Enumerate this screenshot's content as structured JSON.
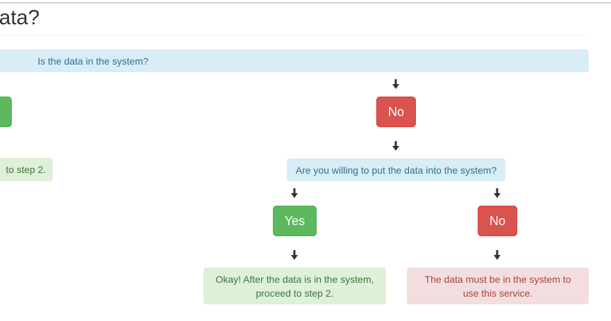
{
  "header": {
    "title": "lata?"
  },
  "question1": {
    "text": "Is the data in the system?"
  },
  "branch_left": {
    "yes_button": "",
    "result_text": "to step 2."
  },
  "branch_right": {
    "no_button": "No"
  },
  "question2": {
    "text": "Are you willing to put the data into the system?"
  },
  "sub_yes": {
    "button": "Yes",
    "result_line1": "Okay! After the data is in the system,",
    "result_line2": "proceed to step 2."
  },
  "sub_no": {
    "button": "No",
    "result_line1": "The data must be in the system to",
    "result_line2": "use this service."
  },
  "icons": {
    "arrow": "arrow-down-icon"
  },
  "colors": {
    "info_bg": "#d9edf7",
    "info_text": "#31708f",
    "success_bg": "#dff0d8",
    "success_text": "#3c763d",
    "danger_bg": "#f2dede",
    "danger_text": "#a94442",
    "btn_success": "#5cb85c",
    "btn_danger": "#d9534f"
  }
}
